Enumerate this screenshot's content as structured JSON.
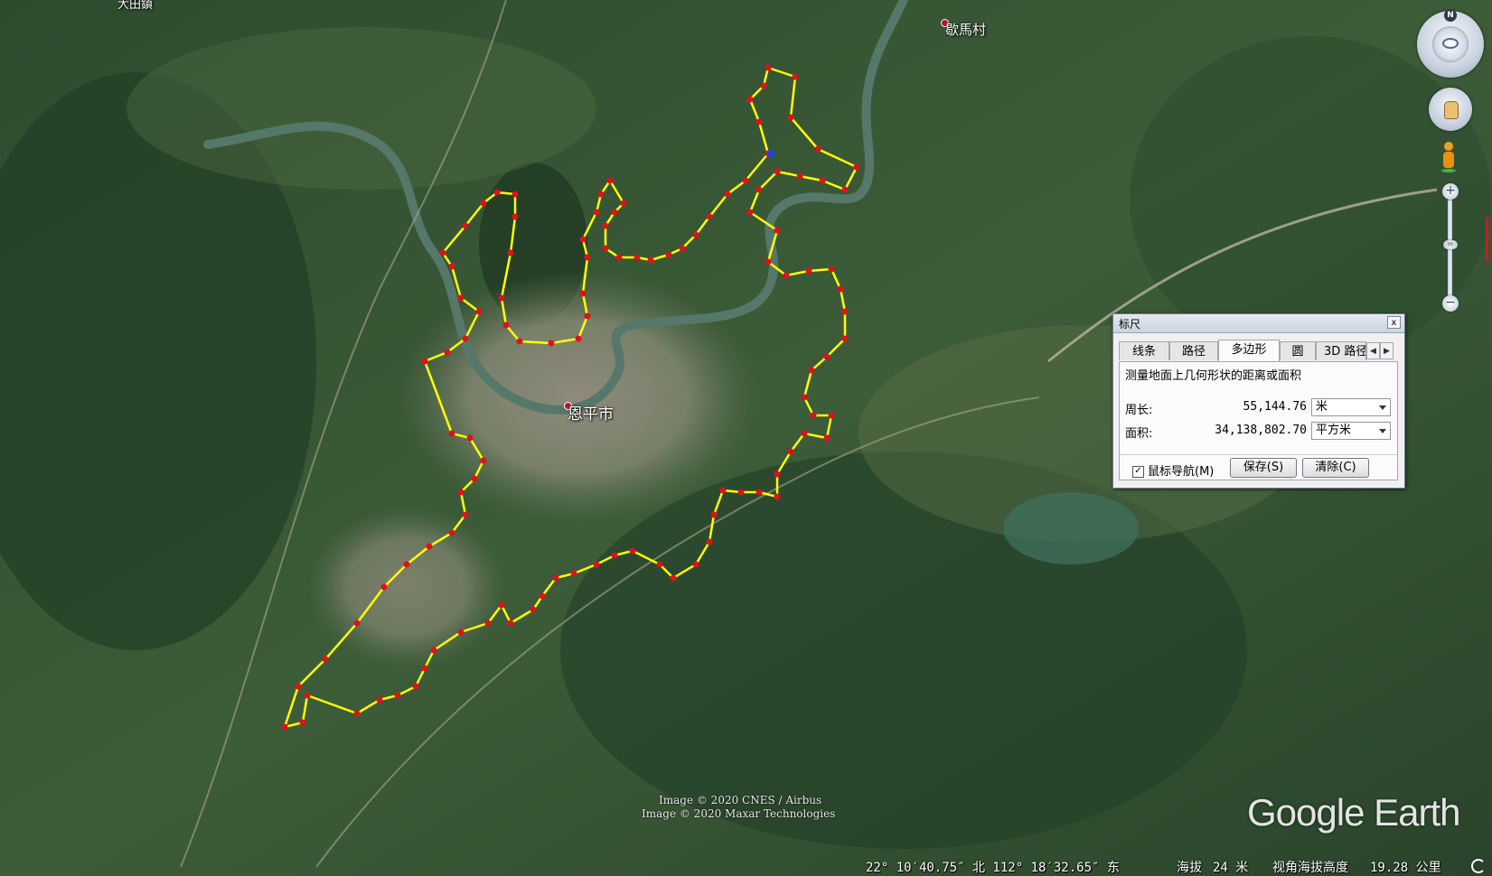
{
  "map": {
    "labels": {
      "city": "恩平市",
      "village": "歇馬村",
      "town_top": "大田鎮"
    },
    "boundary_color": "#ffff00",
    "vertex_color": "#e0101c"
  },
  "ruler": {
    "title": "标尺",
    "close_label": "x",
    "tabs": [
      "线条",
      "路径",
      "多边形",
      "圆",
      "3D 路径"
    ],
    "active_tab": "多边形",
    "description": "测量地面上几何形状的距离或面积",
    "perimeter_label": "周长:",
    "perimeter_value": "55,144.76",
    "perimeter_unit": "米",
    "area_label": "面积:",
    "area_value": "34,138,802.70",
    "area_unit": "平方米",
    "mouse_nav_label": "鼠标导航(M)",
    "mouse_nav_checked": true,
    "save_label": "保存(S)",
    "clear_label": "清除(C)"
  },
  "attribution": {
    "line1": "Image © 2020 CNES / Airbus",
    "line2": "Image © 2020 Maxar Technologies"
  },
  "logo": "Google Earth",
  "status": {
    "coords": "22° 10′40.75″ 北 112° 18′32.65″ 东",
    "elevation_label": "海拔",
    "elevation_value": "24 米",
    "eye_alt_label": "视角海拔高度",
    "eye_alt_value": "19.28 公里"
  },
  "nav": {
    "north": "N",
    "zoom_in": "+",
    "zoom_out": "−",
    "zoom_thumb": "="
  }
}
